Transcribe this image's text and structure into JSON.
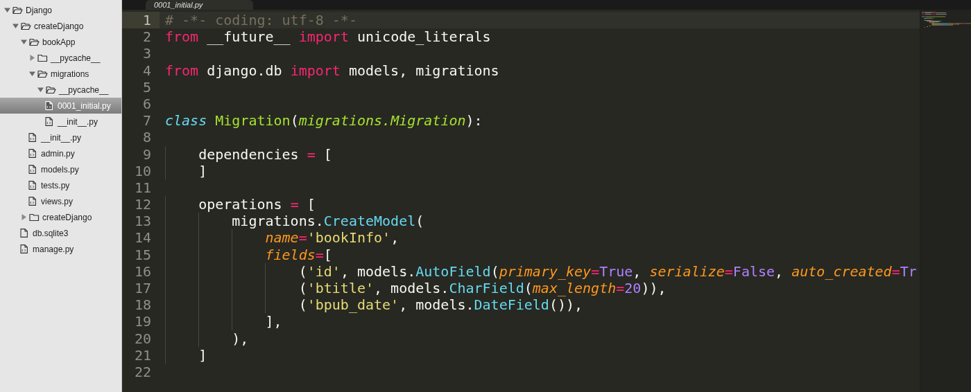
{
  "sidebar": {
    "tree": [
      {
        "kind": "folder",
        "label": "Django",
        "expanded": true,
        "selected": false,
        "children": [
          {
            "kind": "folder",
            "label": "createDjango",
            "expanded": true,
            "selected": false,
            "children": [
              {
                "kind": "folder",
                "label": "bookApp",
                "expanded": true,
                "selected": false,
                "children": [
                  {
                    "kind": "folder",
                    "label": "__pycache__",
                    "expanded": false,
                    "selected": false
                  },
                  {
                    "kind": "folder",
                    "label": "migrations",
                    "expanded": true,
                    "selected": false,
                    "children": [
                      {
                        "kind": "folder",
                        "label": "__pycache__",
                        "expanded": true,
                        "selected": false,
                        "children": [
                          {
                            "kind": "code-file",
                            "label": "0001_initial.py",
                            "selected": true
                          },
                          {
                            "kind": "code-file",
                            "label": "__init__.py",
                            "selected": false
                          }
                        ]
                      }
                    ]
                  },
                  {
                    "kind": "code-file",
                    "label": "__init__.py",
                    "selected": false
                  },
                  {
                    "kind": "code-file",
                    "label": "admin.py",
                    "selected": false
                  },
                  {
                    "kind": "code-file",
                    "label": "models.py",
                    "selected": false
                  },
                  {
                    "kind": "code-file",
                    "label": "tests.py",
                    "selected": false
                  },
                  {
                    "kind": "code-file",
                    "label": "views.py",
                    "selected": false
                  }
                ]
              },
              {
                "kind": "folder",
                "label": "createDjango",
                "expanded": false,
                "selected": false
              },
              {
                "kind": "file",
                "label": "db.sqlite3",
                "selected": false
              },
              {
                "kind": "code-file",
                "label": "manage.py",
                "selected": false
              }
            ]
          }
        ]
      }
    ]
  },
  "tabs": [
    {
      "label": "0001_initial.py",
      "selected": true
    }
  ],
  "editor": {
    "lines": [
      {
        "number": "1",
        "current": true,
        "tokens": [
          {
            "kind": "comment",
            "text": "# -*- coding: utf-8 -*-"
          }
        ]
      },
      {
        "number": "2",
        "current": false,
        "tokens": [
          {
            "kind": "keyword",
            "text": "from"
          },
          {
            "kind": "plain",
            "text": " __future__ "
          },
          {
            "kind": "keyword",
            "text": "import"
          },
          {
            "kind": "plain",
            "text": " unicode_literals"
          }
        ]
      },
      {
        "number": "3",
        "current": false
      },
      {
        "number": "4",
        "current": false,
        "tokens": [
          {
            "kind": "keyword",
            "text": "from"
          },
          {
            "kind": "plain",
            "text": " django.db "
          },
          {
            "kind": "keyword",
            "text": "import"
          },
          {
            "kind": "plain",
            "text": " models, migrations"
          }
        ]
      },
      {
        "number": "5",
        "current": false
      },
      {
        "number": "6",
        "current": false
      },
      {
        "number": "7",
        "current": false,
        "tokens": [
          {
            "kind": "storage",
            "text": "class"
          },
          {
            "kind": "classname",
            "text": " Migration"
          },
          {
            "kind": "plain",
            "text": "("
          },
          {
            "kind": "inherited",
            "text": "migrations.Migration"
          },
          {
            "kind": "plain",
            "text": "):"
          }
        ]
      },
      {
        "number": "8",
        "current": false
      },
      {
        "number": "9",
        "current": false,
        "tokens": [
          {
            "kind": "plain",
            "text": "    dependencies "
          },
          {
            "kind": "keyword",
            "text": "="
          },
          {
            "kind": "plain",
            "text": " ["
          }
        ]
      },
      {
        "number": "10",
        "current": false,
        "tokens": [
          {
            "kind": "plain",
            "text": "    ]"
          }
        ]
      },
      {
        "number": "11",
        "current": false
      },
      {
        "number": "12",
        "current": false,
        "tokens": [
          {
            "kind": "plain",
            "text": "    operations "
          },
          {
            "kind": "keyword",
            "text": "="
          },
          {
            "kind": "plain",
            "text": " ["
          }
        ]
      },
      {
        "number": "13",
        "current": false,
        "tokens": [
          {
            "kind": "plain",
            "text": "        migrations."
          },
          {
            "kind": "function",
            "text": "CreateModel"
          },
          {
            "kind": "plain",
            "text": "("
          }
        ]
      },
      {
        "number": "14",
        "current": false,
        "tokens": [
          {
            "kind": "param",
            "text": "            name"
          },
          {
            "kind": "keyword",
            "text": "="
          },
          {
            "kind": "string",
            "text": "'bookInfo'"
          },
          {
            "kind": "plain",
            "text": ","
          }
        ]
      },
      {
        "number": "15",
        "current": false,
        "tokens": [
          {
            "kind": "param",
            "text": "            fields"
          },
          {
            "kind": "keyword",
            "text": "="
          },
          {
            "kind": "plain",
            "text": "["
          }
        ]
      },
      {
        "number": "16",
        "current": false,
        "tokens": [
          {
            "kind": "plain",
            "text": "                ("
          },
          {
            "kind": "string",
            "text": "'id'"
          },
          {
            "kind": "plain",
            "text": ", models."
          },
          {
            "kind": "function",
            "text": "AutoField"
          },
          {
            "kind": "plain",
            "text": "("
          },
          {
            "kind": "param",
            "text": "primary_key"
          },
          {
            "kind": "keyword",
            "text": "="
          },
          {
            "kind": "constant",
            "text": "True"
          },
          {
            "kind": "plain",
            "text": ", "
          },
          {
            "kind": "param",
            "text": "serialize"
          },
          {
            "kind": "keyword",
            "text": "="
          },
          {
            "kind": "constant",
            "text": "False"
          },
          {
            "kind": "plain",
            "text": ", "
          },
          {
            "kind": "param",
            "text": "auto_created"
          },
          {
            "kind": "keyword",
            "text": "="
          },
          {
            "kind": "constant",
            "text": "Tr"
          }
        ]
      },
      {
        "number": "17",
        "current": false,
        "tokens": [
          {
            "kind": "plain",
            "text": "                ("
          },
          {
            "kind": "string",
            "text": "'btitle'"
          },
          {
            "kind": "plain",
            "text": ", models."
          },
          {
            "kind": "function",
            "text": "CharField"
          },
          {
            "kind": "plain",
            "text": "("
          },
          {
            "kind": "param",
            "text": "max_length"
          },
          {
            "kind": "keyword",
            "text": "="
          },
          {
            "kind": "constant",
            "text": "20"
          },
          {
            "kind": "plain",
            "text": ")),"
          }
        ]
      },
      {
        "number": "18",
        "current": false,
        "tokens": [
          {
            "kind": "plain",
            "text": "                ("
          },
          {
            "kind": "string",
            "text": "'bpub_date'"
          },
          {
            "kind": "plain",
            "text": ", models."
          },
          {
            "kind": "function",
            "text": "DateField"
          },
          {
            "kind": "plain",
            "text": "()),"
          }
        ]
      },
      {
        "number": "19",
        "current": false,
        "tokens": [
          {
            "kind": "plain",
            "text": "            ],"
          }
        ]
      },
      {
        "number": "20",
        "current": false,
        "tokens": [
          {
            "kind": "plain",
            "text": "        ),"
          }
        ]
      },
      {
        "number": "21",
        "current": false,
        "tokens": [
          {
            "kind": "plain",
            "text": "    ]"
          }
        ]
      },
      {
        "number": "22",
        "current": false
      }
    ]
  }
}
